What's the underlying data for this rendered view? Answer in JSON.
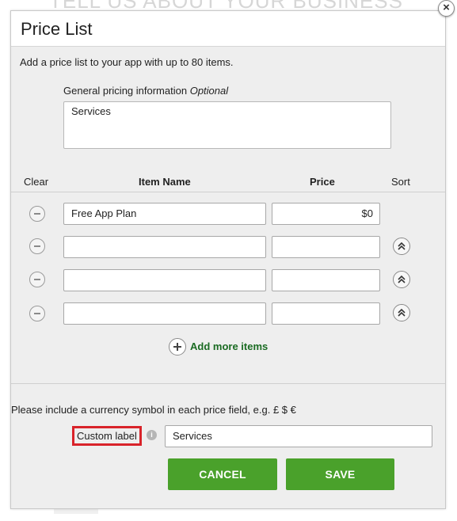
{
  "background": {
    "heading": "TELL US ABOUT YOUR BUSINESS"
  },
  "modal": {
    "title": "Price List",
    "close_label": "×",
    "intro_text": "Add a price list to your app with up to 80 items.",
    "general_pricing": {
      "label": "General pricing information",
      "optional_label": "Optional",
      "value": "Services"
    },
    "columns": {
      "clear": "Clear",
      "item_name": "Item Name",
      "price": "Price",
      "sort": "Sort"
    },
    "items": [
      {
        "name": "Free App Plan",
        "price": "$0"
      },
      {
        "name": "",
        "price": ""
      },
      {
        "name": "",
        "price": ""
      },
      {
        "name": "",
        "price": ""
      }
    ],
    "add_more_label": "Add more items",
    "currency_note": "Please include a currency symbol in each price field, e.g. £ $ €",
    "custom_label": {
      "label": "Custom label",
      "info_icon": "i",
      "value": "Services"
    },
    "buttons": {
      "cancel": "CANCEL",
      "save": "SAVE"
    }
  },
  "colors": {
    "accent_green": "#4aa12b",
    "link_green": "#1a6b22",
    "highlight_red": "#d9232a"
  }
}
